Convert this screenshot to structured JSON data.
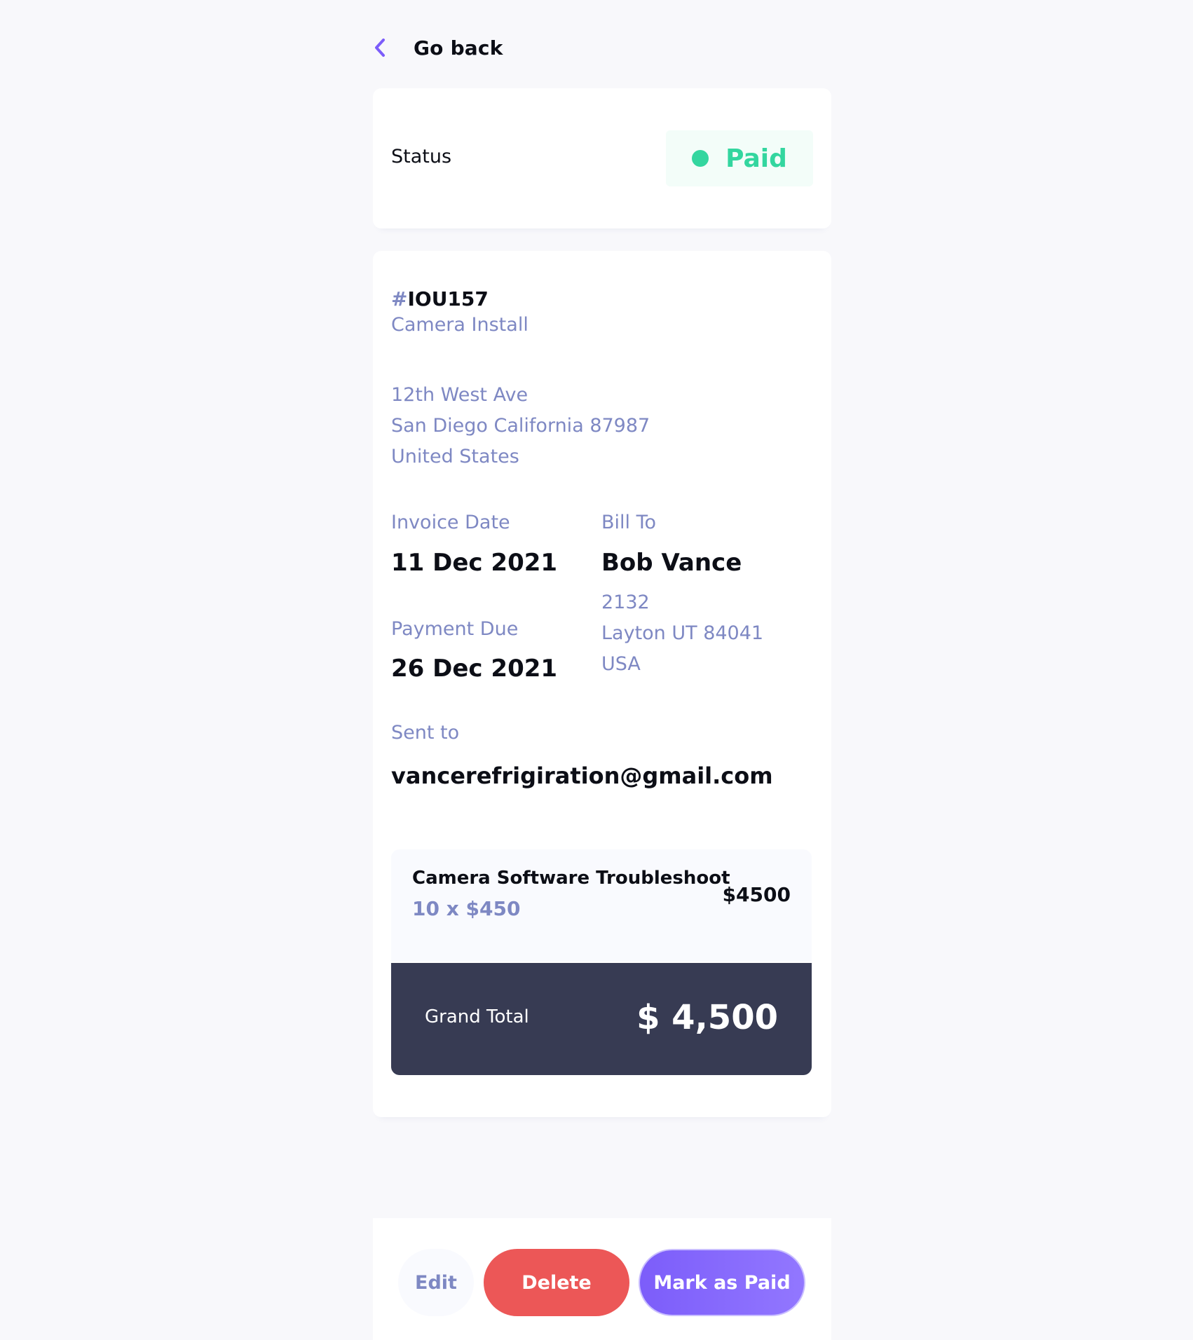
{
  "nav": {
    "back_label": "Go back"
  },
  "status": {
    "label": "Status",
    "value": "Paid",
    "color": "#33D69F"
  },
  "invoice": {
    "id_prefix": "#",
    "id": "IOU157",
    "description": "Camera Install",
    "sender_address": {
      "street": "12th West Ave",
      "city_line": "San Diego California 87987",
      "country": "United States"
    },
    "invoice_date_label": "Invoice Date",
    "invoice_date": "11 Dec 2021",
    "payment_due_label": "Payment Due",
    "payment_due": "26 Dec 2021",
    "bill_to_label": "Bill To",
    "client_name": "Bob Vance",
    "client_address": {
      "street": "2132",
      "city_line": "Layton UT 84041",
      "country": "USA"
    },
    "sent_to_label": "Sent to",
    "client_email": "vancerefrigiration@gmail.com",
    "items": [
      {
        "name": "Camera Software Troubleshoot",
        "quantity_price": "10 x $450",
        "total": "$4500"
      }
    ],
    "grand_total_label": "Grand Total",
    "grand_total": "$ 4,500"
  },
  "actions": {
    "edit_label": "Edit",
    "delete_label": "Delete",
    "mark_paid_label": "Mark as Paid"
  },
  "colors": {
    "accent": "#7C5DFA",
    "danger": "#EC5757",
    "muted_text": "#7E88C3",
    "dark_panel": "#373B53",
    "background": "#F8F8FB"
  }
}
